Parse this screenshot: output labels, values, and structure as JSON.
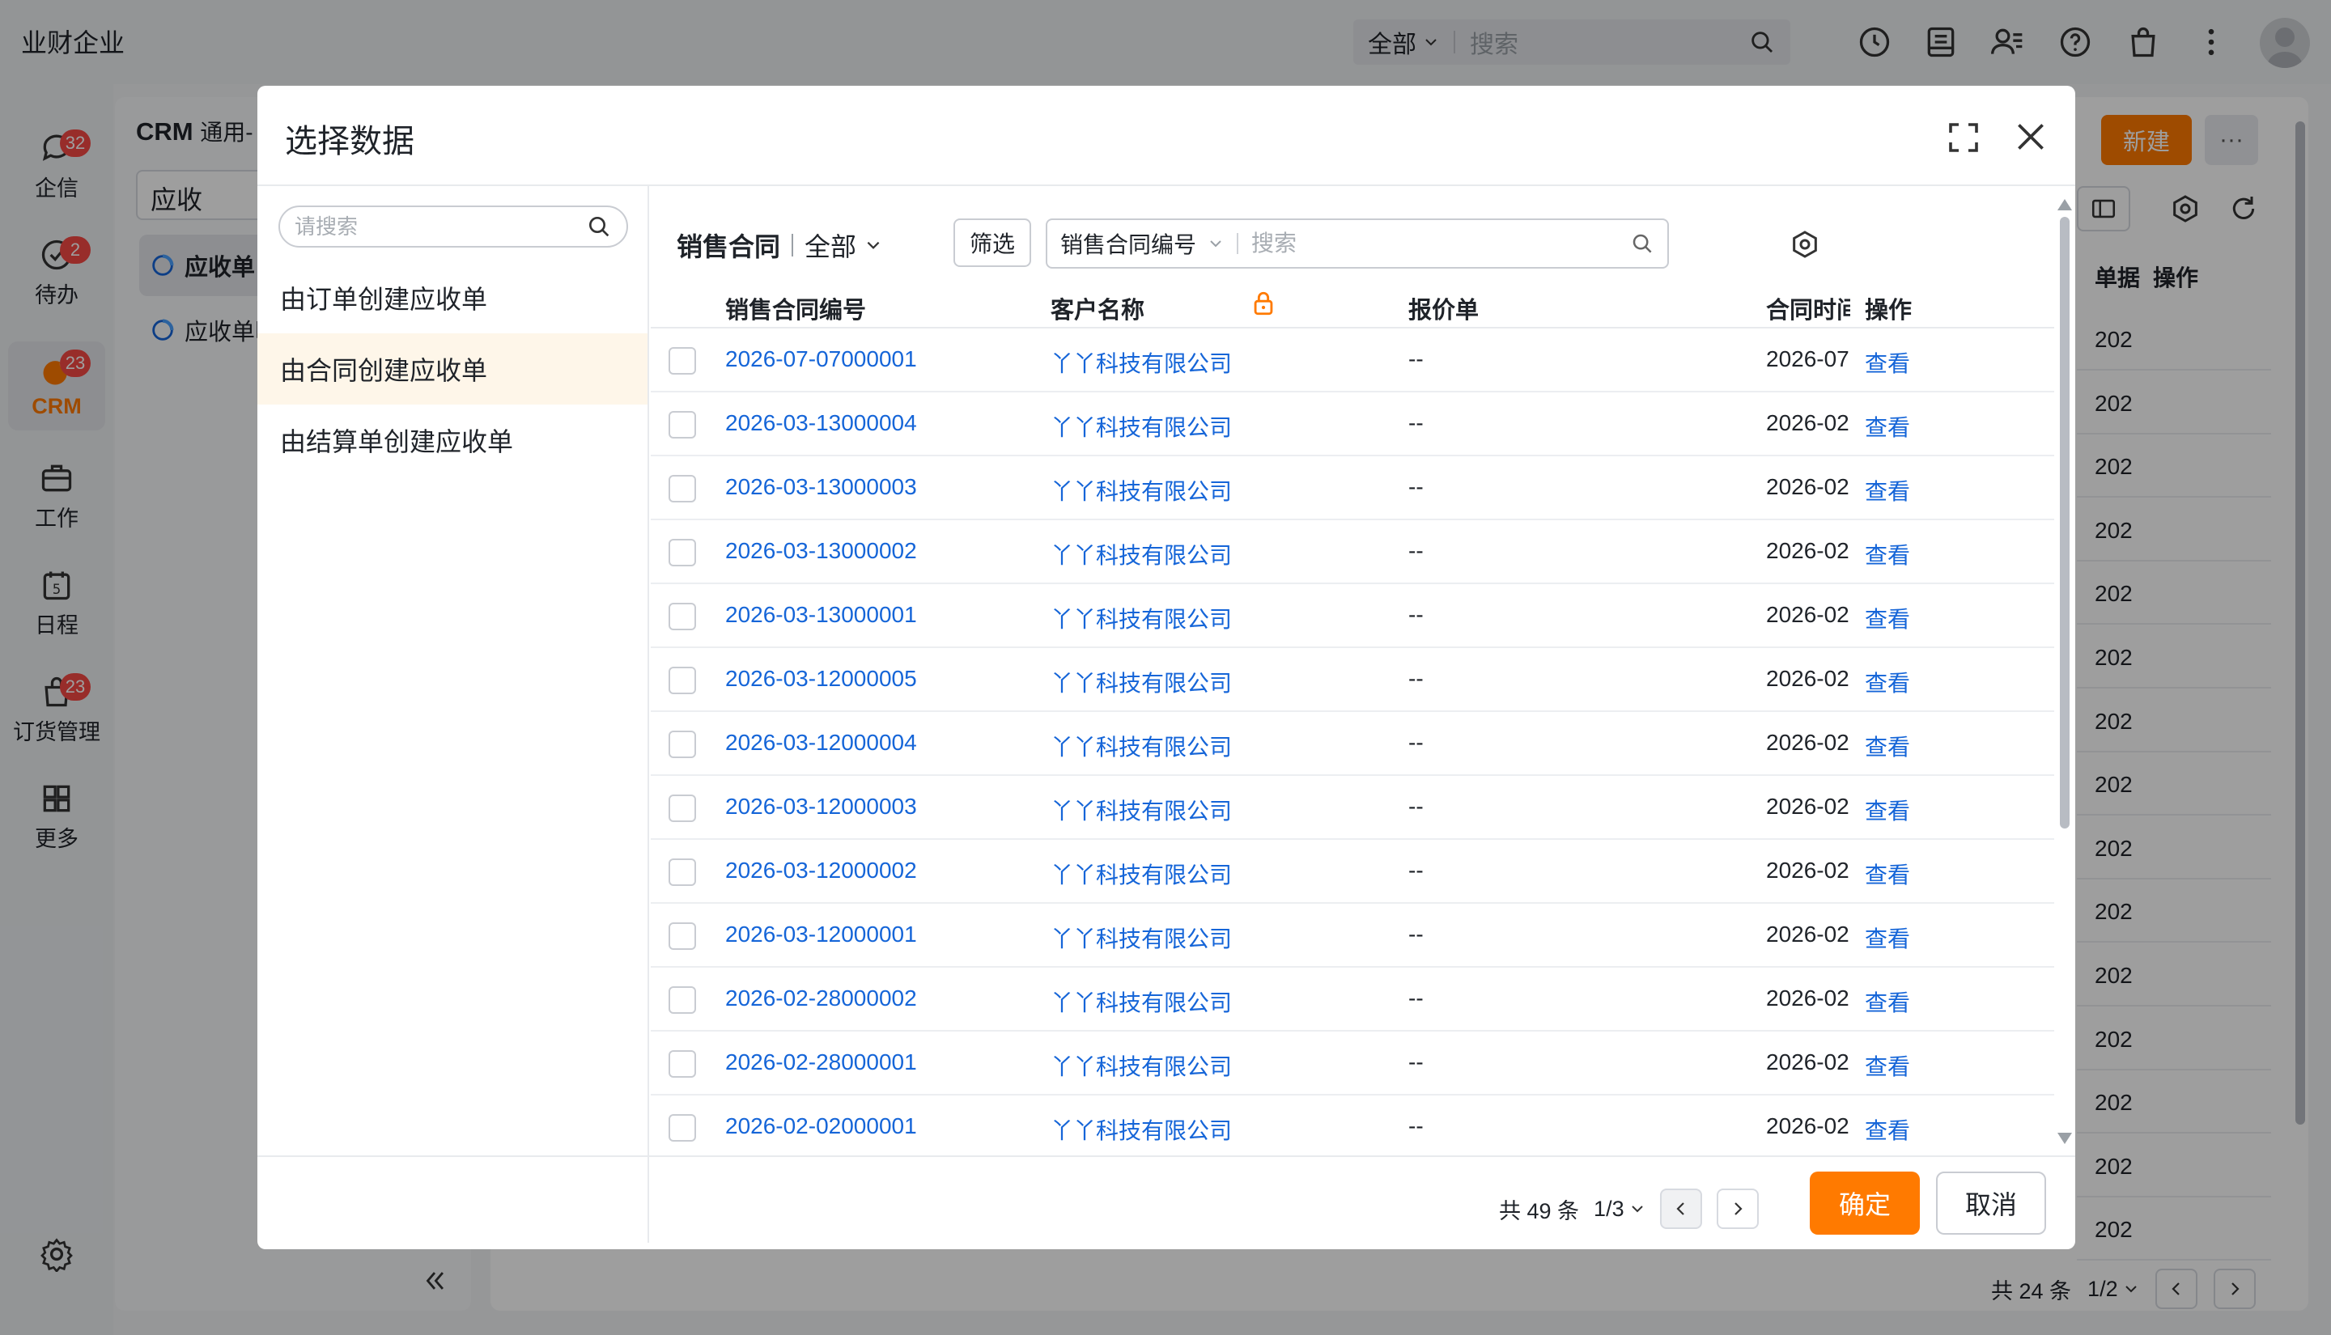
{
  "app": {
    "brand": "业财企业"
  },
  "topbar": {
    "search_scope": "全部",
    "search_placeholder": "搜索"
  },
  "sidenav": {
    "items": [
      {
        "label": "企信",
        "badge": "32"
      },
      {
        "label": "待办",
        "badge": "2"
      },
      {
        "label": "CRM",
        "badge": "23"
      },
      {
        "label": "工作",
        "badge": ""
      },
      {
        "label": "日程",
        "badge": ""
      },
      {
        "label": "订货管理",
        "badge": "23"
      },
      {
        "label": "更多",
        "badge": ""
      }
    ],
    "calendar_day": "5"
  },
  "crm": {
    "title_main": "CRM",
    "title_sub": "通用-",
    "input_value": "应收",
    "items": [
      "应收单",
      "应收单明"
    ]
  },
  "background_list": {
    "new_label": "新建",
    "more_label": "···",
    "headers": [
      "单据",
      "操作"
    ],
    "cell_text": "202",
    "total": "共 24 条",
    "page": "1/2"
  },
  "modal": {
    "title": "选择数据",
    "left_search_placeholder": "请搜索",
    "left_items": [
      "由订单创建应收单",
      "由合同创建应收单",
      "由结算单创建应收单"
    ],
    "source": "销售合同",
    "scope": "全部",
    "filter_label": "筛选",
    "search_field": "销售合同编号",
    "search_placeholder": "搜索",
    "new_label": "新建",
    "columns": [
      "销售合同编号",
      "客户名称",
      "报价单",
      "合同时间",
      "操作"
    ],
    "rows": [
      {
        "code": "2026-07-07000001",
        "customer": "丫丫科技有限公司",
        "quote": "--",
        "date": "2026-07",
        "action": "查看"
      },
      {
        "code": "2026-03-13000004",
        "customer": "丫丫科技有限公司",
        "quote": "--",
        "date": "2026-02",
        "action": "查看"
      },
      {
        "code": "2026-03-13000003",
        "customer": "丫丫科技有限公司",
        "quote": "--",
        "date": "2026-02",
        "action": "查看"
      },
      {
        "code": "2026-03-13000002",
        "customer": "丫丫科技有限公司",
        "quote": "--",
        "date": "2026-02",
        "action": "查看"
      },
      {
        "code": "2026-03-13000001",
        "customer": "丫丫科技有限公司",
        "quote": "--",
        "date": "2026-02",
        "action": "查看"
      },
      {
        "code": "2026-03-12000005",
        "customer": "丫丫科技有限公司",
        "quote": "--",
        "date": "2026-02",
        "action": "查看"
      },
      {
        "code": "2026-03-12000004",
        "customer": "丫丫科技有限公司",
        "quote": "--",
        "date": "2026-02",
        "action": "查看"
      },
      {
        "code": "2026-03-12000003",
        "customer": "丫丫科技有限公司",
        "quote": "--",
        "date": "2026-02",
        "action": "查看"
      },
      {
        "code": "2026-03-12000002",
        "customer": "丫丫科技有限公司",
        "quote": "--",
        "date": "2026-02",
        "action": "查看"
      },
      {
        "code": "2026-03-12000001",
        "customer": "丫丫科技有限公司",
        "quote": "--",
        "date": "2026-02",
        "action": "查看"
      },
      {
        "code": "2026-02-28000002",
        "customer": "丫丫科技有限公司",
        "quote": "--",
        "date": "2026-02",
        "action": "查看"
      },
      {
        "code": "2026-02-28000001",
        "customer": "丫丫科技有限公司",
        "quote": "--",
        "date": "2026-02",
        "action": "查看"
      },
      {
        "code": "2026-02-02000001",
        "customer": "丫丫科技有限公司",
        "quote": "--",
        "date": "2026-02",
        "action": "查看"
      }
    ],
    "pagination": {
      "total": "共 49 条",
      "page": "1/3"
    },
    "ok_label": "确定",
    "cancel_label": "取消"
  },
  "colors": {
    "accent": "#ff7a00",
    "link": "#1565d8",
    "badge": "#f54a45",
    "selected_bg": "#fef6e9"
  }
}
